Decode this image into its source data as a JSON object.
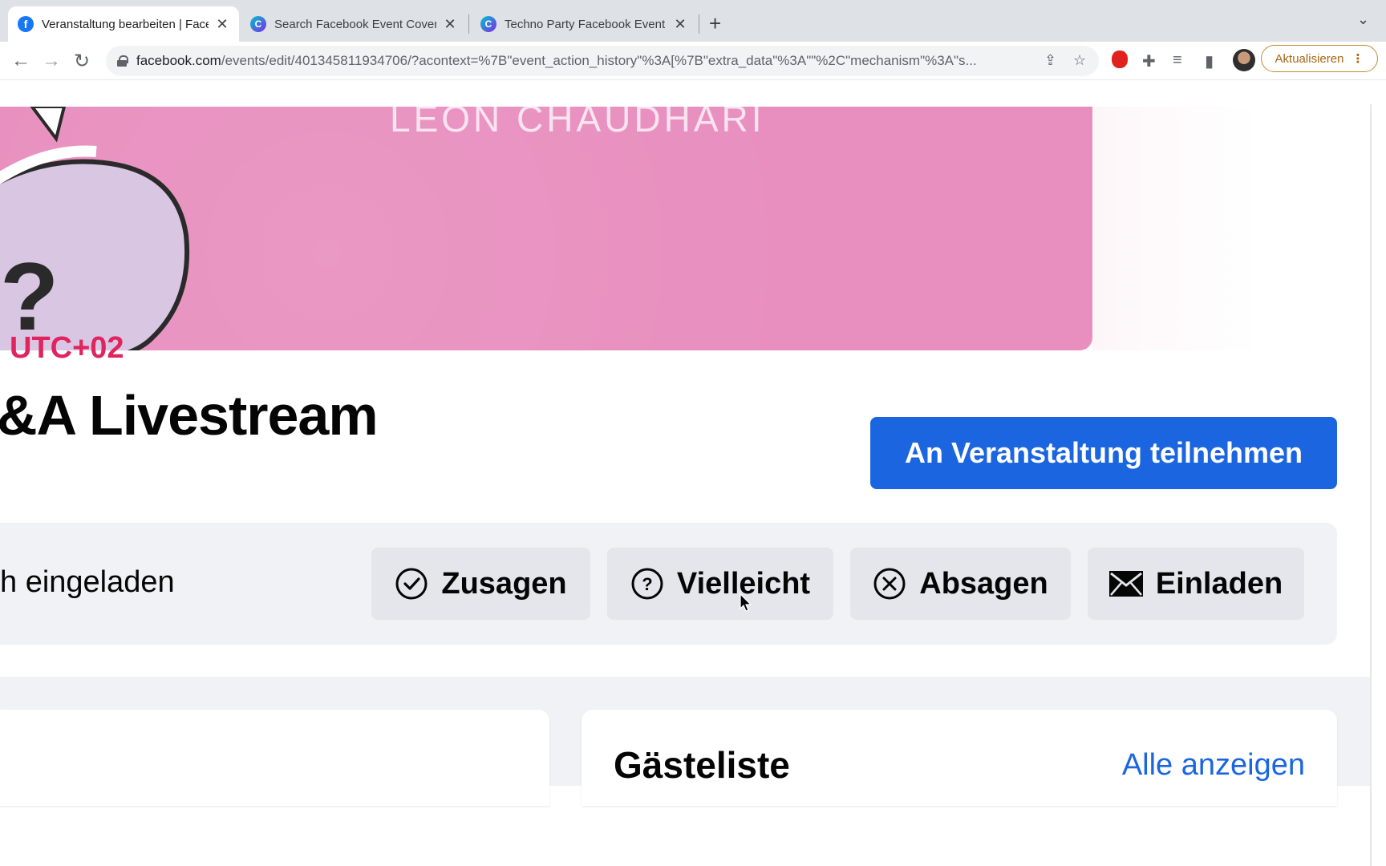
{
  "browser": {
    "tabs": [
      {
        "title": "Veranstaltung bearbeiten | Face",
        "favicon": "facebook-icon",
        "active": true
      },
      {
        "title": "Search Facebook Event Cover",
        "favicon": "canva-icon",
        "active": false
      },
      {
        "title": "Techno Party Facebook Event C",
        "favicon": "canva-icon",
        "active": false
      }
    ],
    "url_domain": "facebook.com",
    "url_rest": "/events/edit/401345811934706/?acontext=%7B\"event_action_history\"%3A[%7B\"extra_data\"%3A\"\"%2C\"mechanism\"%3A\"s...",
    "update_label": "Aktualisieren"
  },
  "event": {
    "cover_text": "LEON CHAUDHARI",
    "time_label": "UTC+02",
    "title": "&A Livestream",
    "join_label": "An Veranstaltung teilnehmen",
    "invited_text": "h eingeladen",
    "actions": [
      {
        "label": "Zusagen",
        "icon": "check-circle-icon"
      },
      {
        "label": "Vielleicht",
        "icon": "question-circle-icon"
      },
      {
        "label": "Absagen",
        "icon": "x-circle-icon"
      },
      {
        "label": "Einladen",
        "icon": "envelope-icon"
      }
    ]
  },
  "guest_list": {
    "title": "Gästeliste",
    "see_all_label": "Alle anzeigen"
  },
  "colors": {
    "accent_blue": "#1b66e0",
    "time_red": "#e0245e",
    "cover_pink": "#e88fbf"
  }
}
